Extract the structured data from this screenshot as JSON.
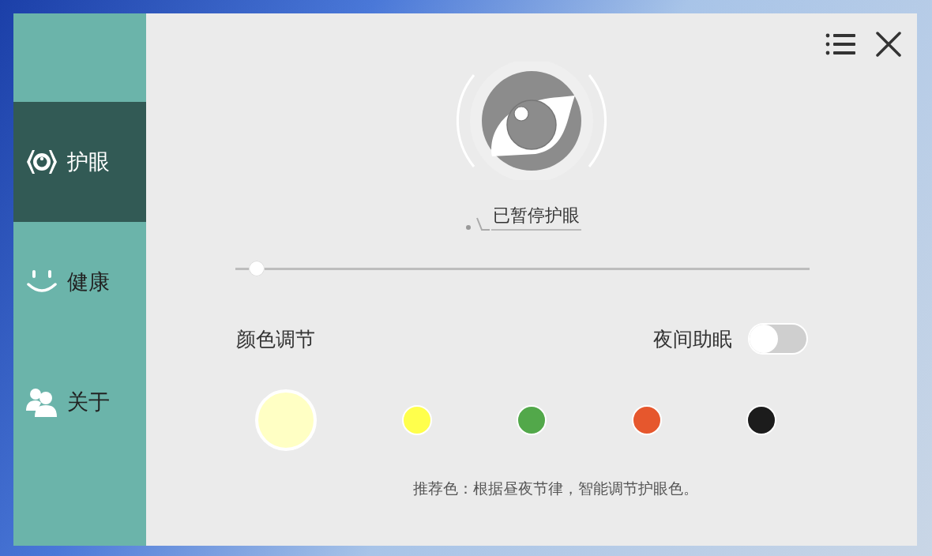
{
  "sidebar": {
    "items": [
      {
        "label": "护眼",
        "kind": "eye",
        "selected": true
      },
      {
        "label": "健康",
        "kind": "smile",
        "selected": false
      },
      {
        "label": "关于",
        "kind": "users",
        "selected": false
      }
    ]
  },
  "status": {
    "text": "已暂停护眼"
  },
  "intensity": {
    "level": 0.025
  },
  "color_adjust": {
    "label": "颜色调节"
  },
  "night_mode": {
    "label": "夜间助眠",
    "on": false
  },
  "swatches": [
    {
      "color": "#ffffc4",
      "selected": true
    },
    {
      "color": "#ffff4c",
      "selected": false
    },
    {
      "color": "#52a84a",
      "selected": false
    },
    {
      "color": "#e6572d",
      "selected": false
    },
    {
      "color": "#1c1c1c",
      "selected": false
    }
  ],
  "hint": "推荐色：根据昼夜节律，智能调节护眼色。"
}
